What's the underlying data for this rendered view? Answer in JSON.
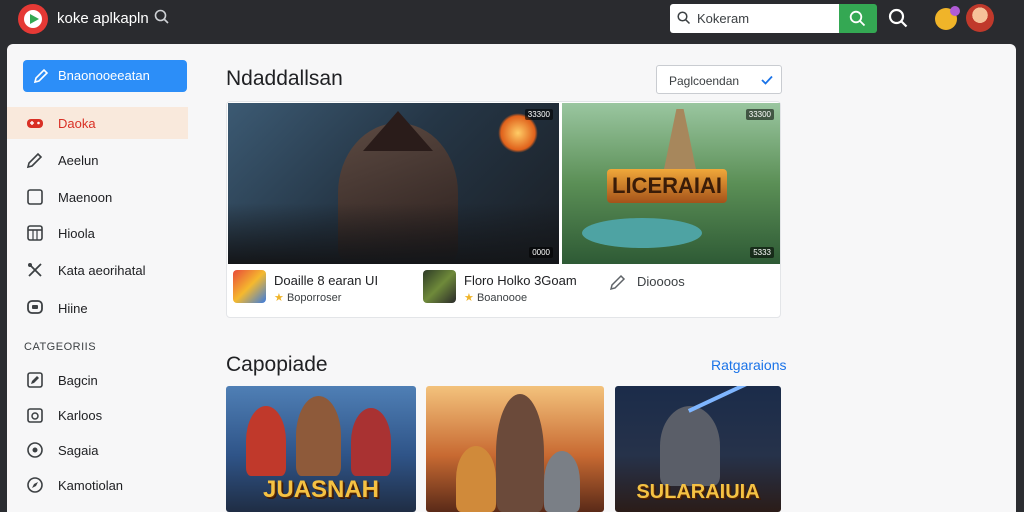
{
  "header": {
    "app_title": "koke aplkapln",
    "search_placeholder": "Kokeram"
  },
  "sidebar": {
    "cta_label": "Bnaonooeeatan",
    "items": [
      {
        "label": "Daoka",
        "icon": "gamepad-icon",
        "active": true
      },
      {
        "label": "Aeelun",
        "icon": "pencil-icon",
        "active": false
      },
      {
        "label": "Maenoon",
        "icon": "square-icon",
        "active": false
      },
      {
        "label": "Hioola",
        "icon": "calendar-icon",
        "active": false
      },
      {
        "label": "Kata aeorihatal",
        "icon": "tools-icon",
        "active": false
      },
      {
        "label": "Hiine",
        "icon": "chat-icon",
        "active": false
      }
    ],
    "categories_heading": "CATGEORIIS",
    "categories": [
      {
        "label": "Bagcin",
        "icon": "edit-icon"
      },
      {
        "label": "Karloos",
        "icon": "frame-icon"
      },
      {
        "label": "Sagaia",
        "icon": "clock-icon"
      },
      {
        "label": "Kamotiolan",
        "icon": "compass-icon"
      }
    ]
  },
  "main": {
    "featured_title": "Ndaddallsan",
    "sort_dropdown": "Paglcoendan",
    "banner_badges": [
      "33300",
      "0000",
      "33300",
      "5333"
    ],
    "banner2_logo": "LICERAIAI",
    "featured_games": [
      {
        "name": "Doaille 8 earan UI",
        "meta": "Boporroser"
      },
      {
        "name": "Floro Holko 3Goam",
        "meta": "Boanoooe"
      }
    ],
    "more_label": "Dioooos",
    "section2_title": "Capopiade",
    "see_all": "Ratgaraions",
    "game_cards": [
      {
        "title": "JUASNAH"
      },
      {
        "title": ""
      },
      {
        "title": "SULARAIUIA"
      }
    ]
  }
}
